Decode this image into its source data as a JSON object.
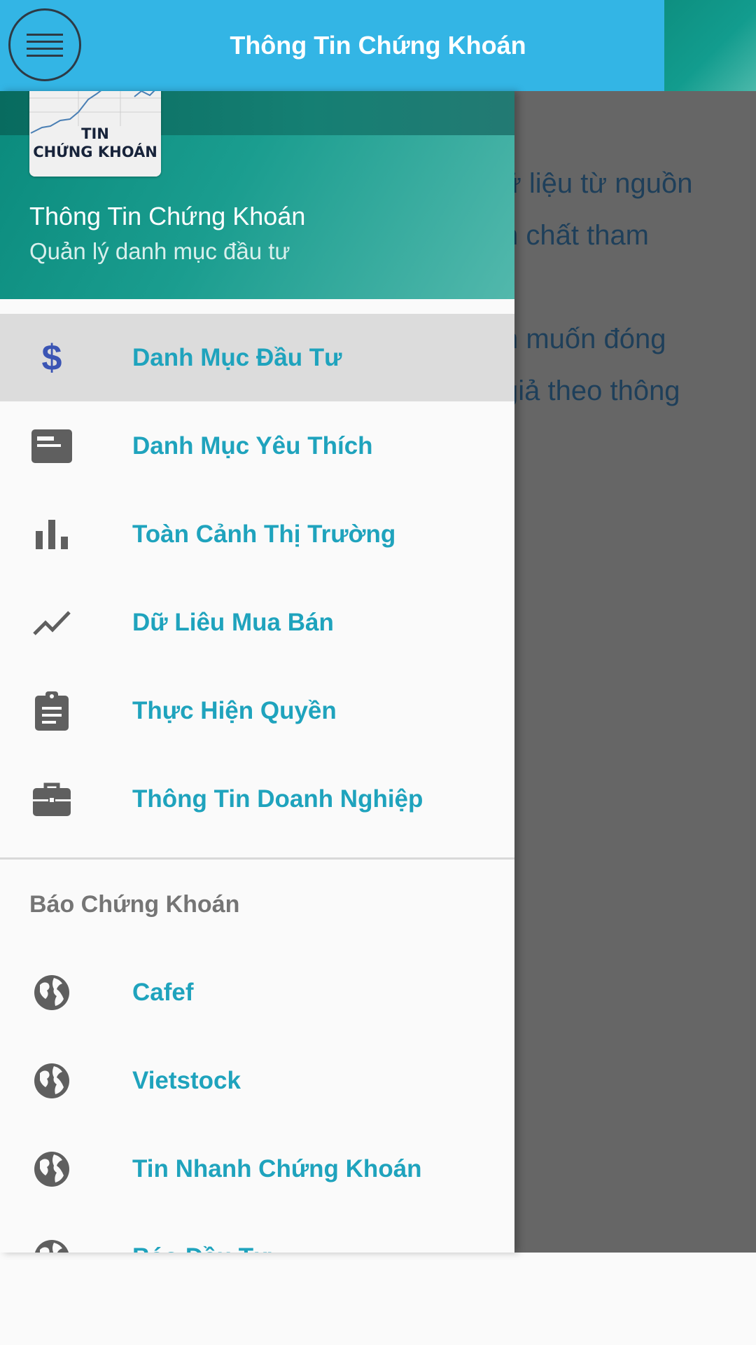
{
  "app_bar": {
    "title": "Thông Tin Chứng Khoán",
    "menu_icon": "hamburger-menu-icon"
  },
  "drawer": {
    "header": {
      "logo_line1": "TIN",
      "logo_line2": "CHỨNG KHOÁN",
      "title": "Thông Tin Chứng Khoán",
      "subtitle": "Quản lý danh mục đầu tư"
    },
    "main_items": [
      {
        "label": "Danh Mục Đầu Tư",
        "icon": "dollar-icon",
        "active": true
      },
      {
        "label": "Danh Mục Yêu Thích",
        "icon": "card-icon",
        "active": false
      },
      {
        "label": "Toàn Cảnh Thị Trường",
        "icon": "bar-chart-icon",
        "active": false
      },
      {
        "label": "Dữ Liêu Mua Bán",
        "icon": "trending-line-icon",
        "active": false
      },
      {
        "label": "Thực Hiện Quyền",
        "icon": "clipboard-icon",
        "active": false
      },
      {
        "label": "Thông Tin Doanh Nghiệp",
        "icon": "briefcase-icon",
        "active": false
      }
    ],
    "section_title": "Báo Chứng Khoán",
    "news_items": [
      {
        "label": "Cafef",
        "icon": "globe-icon"
      },
      {
        "label": "Vietstock",
        "icon": "globe-icon"
      },
      {
        "label": "Tin Nhanh Chứng Khoán",
        "icon": "globe-icon"
      },
      {
        "label": "Báo Đầu Tư",
        "icon": "globe-icon"
      }
    ]
  },
  "background_content": {
    "lines": [
      "ữ liệu từ nguồn",
      "h chất tham",
      "n muốn đóng",
      "giả theo thông"
    ]
  },
  "colors": {
    "app_bar": "#33b5e5",
    "drawer_header": "#1a9d8f",
    "item_label": "#1fa3bd",
    "active_row": "#dcdcdc",
    "dim_overlay": "#666666"
  }
}
